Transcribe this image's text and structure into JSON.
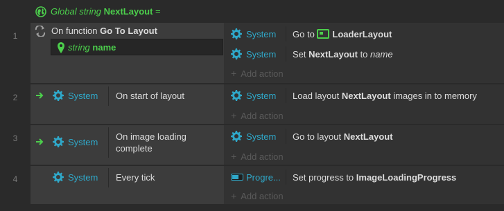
{
  "global": {
    "prefix": "Global string",
    "name": "NextLayout",
    "suffix": "=",
    "icon": "globe-icon"
  },
  "events": [
    {
      "number": "1",
      "condition": {
        "prefix": "On function",
        "name": "Go To Layout",
        "param_type": "string",
        "param_name": "name"
      },
      "actions": [
        {
          "object": "System",
          "text_a": "Go to",
          "bold": "LoaderLayout",
          "text_b": "",
          "italic": ""
        },
        {
          "object": "System",
          "text_a": "Set",
          "bold": "NextLayout",
          "text_b": "to",
          "italic": "name"
        }
      ],
      "add_action": "Add action"
    },
    {
      "number": "2",
      "condition": {
        "object": "System",
        "text": "On start of layout"
      },
      "actions": [
        {
          "object": "System",
          "text_a": "Load layout",
          "bold": "NextLayout",
          "text_b": "images in to memory"
        }
      ],
      "add_action": "Add action"
    },
    {
      "number": "3",
      "condition": {
        "object": "System",
        "text_line1": "On image loading",
        "text_line2": "complete"
      },
      "actions": [
        {
          "object": "System",
          "text_a": "Go to layout",
          "bold": "NextLayout",
          "text_b": ""
        }
      ],
      "add_action": "Add action"
    },
    {
      "number": "4",
      "condition": {
        "object": "System",
        "text": "Every tick"
      },
      "actions": [
        {
          "object": "Progre...",
          "text_a": "Set progress to",
          "bold": "ImageLoadingProgress",
          "text_b": ""
        }
      ],
      "add_action": "Add action"
    }
  ],
  "colors": {
    "accent_blue": "#2fa8c9",
    "accent_green": "#4ccf4c",
    "text": "#dcdcdc"
  }
}
